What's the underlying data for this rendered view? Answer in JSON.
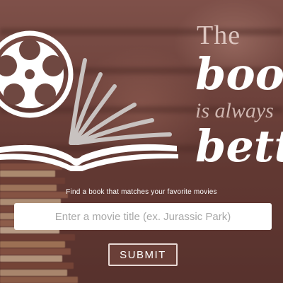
{
  "headline": {
    "line1": "The",
    "line2": "book",
    "line3": "is always",
    "line4": "better"
  },
  "tagline": "Find a book that matches your favorite movies",
  "search": {
    "value": "",
    "placeholder": "Enter a movie title (ex. Jurassic Park)"
  },
  "submit_label": "SUBMIT",
  "colors": {
    "background": "#5a3a33",
    "button_fill": "#6a3f38",
    "button_border": "#e9d9d5",
    "text": "#ffffff"
  },
  "icons": {
    "logo": "film-reel-book-icon"
  }
}
